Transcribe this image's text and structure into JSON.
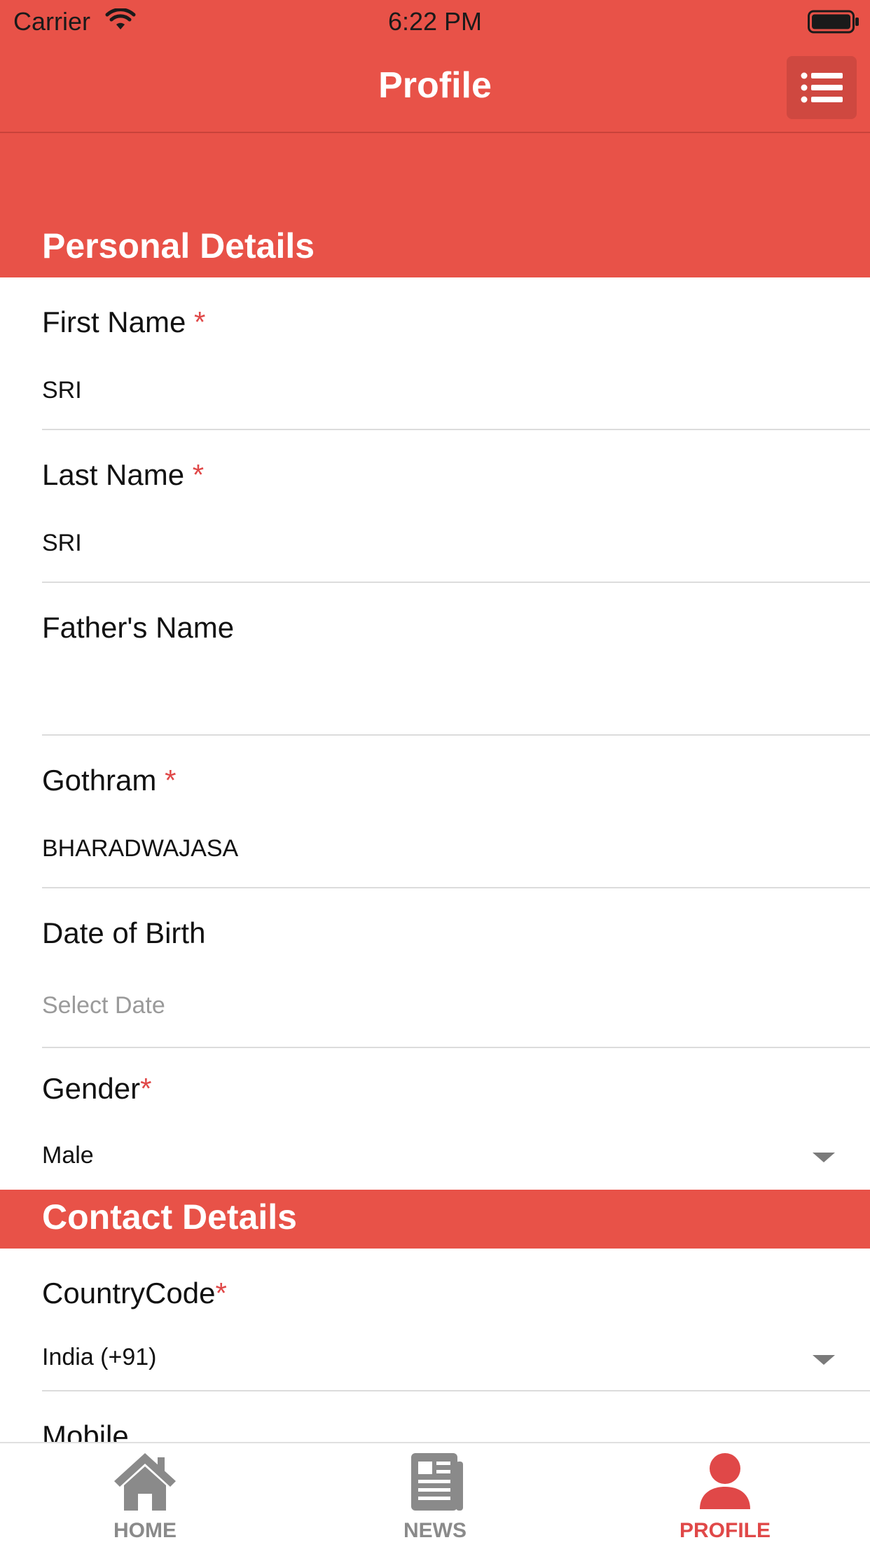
{
  "status": {
    "carrier": "Carrier",
    "time": "6:22 PM"
  },
  "header": {
    "title": "Profile"
  },
  "sections": {
    "personal": "Personal Details",
    "contact": "Contact Details"
  },
  "fields": {
    "first_name": {
      "label": "First Name",
      "required": "*",
      "value": "SRI"
    },
    "last_name": {
      "label": "Last Name",
      "required": "*",
      "value": "SRI"
    },
    "fathers_name": {
      "label": "Father's Name",
      "value": ""
    },
    "gothram": {
      "label": "Gothram",
      "required": "*",
      "value": "BHARADWAJASA"
    },
    "dob": {
      "label": "Date of Birth",
      "placeholder": "Select Date"
    },
    "gender": {
      "label": "Gender",
      "required": "*",
      "value": "Male"
    },
    "country_code": {
      "label": "CountryCode",
      "required": "*",
      "value": "India (+91)"
    },
    "mobile": {
      "label": "Mobile"
    }
  },
  "tabs": [
    {
      "label": "HOME",
      "icon": "home-icon"
    },
    {
      "label": "NEWS",
      "icon": "news-icon"
    },
    {
      "label": "PROFILE",
      "icon": "profile-icon"
    }
  ],
  "colors": {
    "brand": "#e85248",
    "required": "#e04848",
    "tab_inactive": "#8a8a8a"
  }
}
